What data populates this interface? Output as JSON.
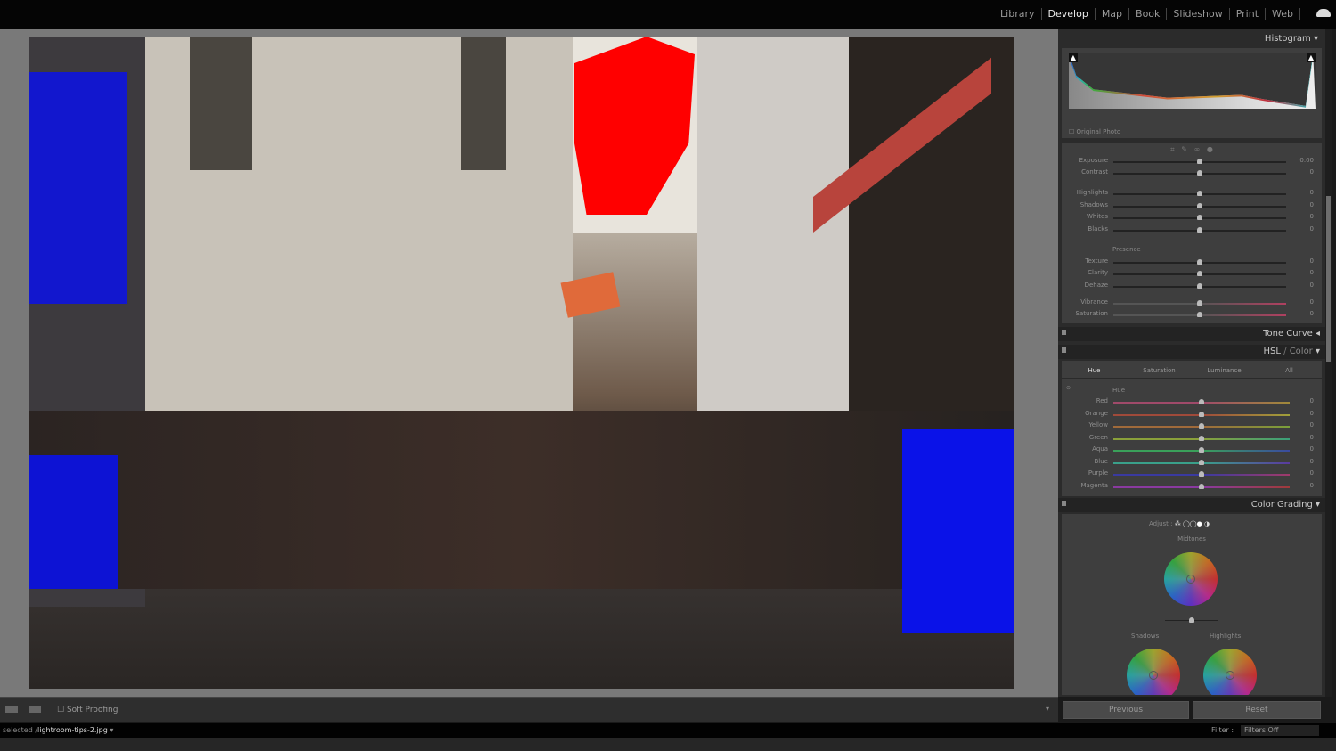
{
  "modules": [
    "Library",
    "Develop",
    "Map",
    "Book",
    "Slideshow",
    "Print",
    "Web"
  ],
  "active_module": "Develop",
  "histogram": {
    "title": "Histogram",
    "original_photo_label": "Original Photo"
  },
  "basic": {
    "rows": [
      {
        "label": "Exposure",
        "value": "0.00"
      },
      {
        "label": "Contrast",
        "value": "0"
      },
      {
        "label": "Highlights",
        "value": "0"
      },
      {
        "label": "Shadows",
        "value": "0"
      },
      {
        "label": "Whites",
        "value": "0"
      },
      {
        "label": "Blacks",
        "value": "0"
      }
    ],
    "presence_label": "Presence",
    "presence": [
      {
        "label": "Texture",
        "value": "0"
      },
      {
        "label": "Clarity",
        "value": "0"
      },
      {
        "label": "Dehaze",
        "value": "0"
      },
      {
        "label": "Vibrance",
        "value": "0"
      },
      {
        "label": "Saturation",
        "value": "0"
      }
    ]
  },
  "tone_curve": {
    "title": "Tone Curve"
  },
  "hsl": {
    "title_hsl": "HSL",
    "title_sep": " / ",
    "title_color": "Color",
    "tabs": [
      "Hue",
      "Saturation",
      "Luminance",
      "All"
    ],
    "active_tab": "Hue",
    "group_label": "Hue",
    "rows": [
      {
        "label": "Red",
        "value": "0",
        "colors": [
          "#a04a6a",
          "#a08a3a"
        ]
      },
      {
        "label": "Orange",
        "value": "0",
        "colors": [
          "#a04a3a",
          "#a0a03a"
        ]
      },
      {
        "label": "Yellow",
        "value": "0",
        "colors": [
          "#a06a3a",
          "#7aa03a"
        ]
      },
      {
        "label": "Green",
        "value": "0",
        "colors": [
          "#8aa03a",
          "#3aa07a"
        ]
      },
      {
        "label": "Aqua",
        "value": "0",
        "colors": [
          "#3aa05a",
          "#3a4aa0"
        ]
      },
      {
        "label": "Blue",
        "value": "0",
        "colors": [
          "#3aa08a",
          "#5a3aa0"
        ]
      },
      {
        "label": "Purple",
        "value": "0",
        "colors": [
          "#3a3aa0",
          "#a03a6a"
        ]
      },
      {
        "label": "Magenta",
        "value": "0",
        "colors": [
          "#8a3aa0",
          "#a03a3a"
        ]
      }
    ]
  },
  "color_grading": {
    "title": "Color Grading",
    "adjust_label": "Adjust :",
    "midtones": "Midtones",
    "shadows": "Shadows",
    "highlights": "Highlights"
  },
  "buttons": {
    "previous": "Previous",
    "reset": "Reset"
  },
  "toolbar": {
    "soft_proofing": "Soft Proofing"
  },
  "filmstrip": {
    "selected_prefix": "selected /",
    "filename": "lightroom-tips-2.jpg",
    "filter_label": "Filter :",
    "filter_value": "Filters Off"
  }
}
